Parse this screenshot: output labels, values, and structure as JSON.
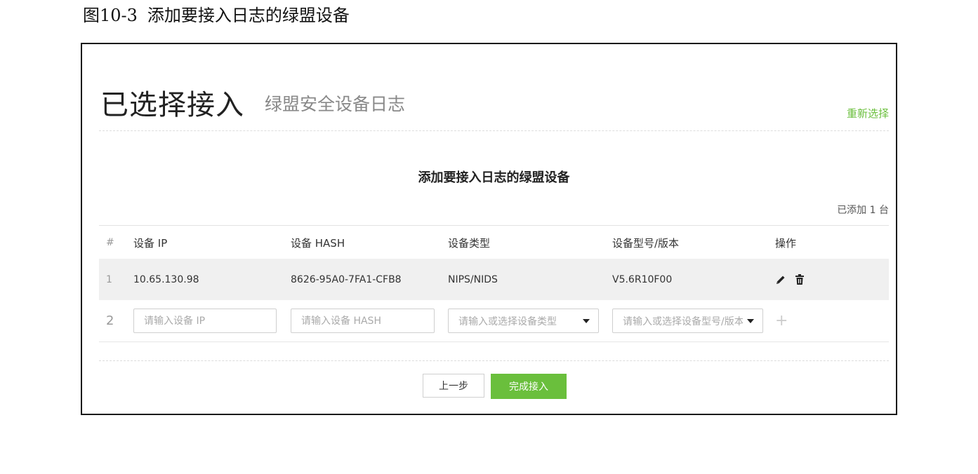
{
  "caption": {
    "number": "图10-3",
    "text": "添加要接入日志的绿盟设备"
  },
  "header": {
    "title": "已选择接入",
    "subtitle": "绿盟安全设备日志",
    "reselect_link": "重新选择"
  },
  "section_title": "添加要接入日志的绿盟设备",
  "added_count": "已添加 1 台",
  "table": {
    "columns": [
      "#",
      "设备 IP",
      "设备 HASH",
      "设备类型",
      "设备型号/版本",
      "操作"
    ],
    "rows": [
      {
        "index": "1",
        "ip": "10.65.130.98",
        "hash": "8626-95A0-7FA1-CFB8",
        "type": "NIPS/NIDS",
        "model": "V5.6R10F00"
      }
    ],
    "new_row": {
      "index": "2",
      "ip_placeholder": "请输入设备 IP",
      "hash_placeholder": "请输入设备 HASH",
      "type_placeholder": "请输入或选择设备类型",
      "model_placeholder": "请输入或选择设备型号/版本"
    }
  },
  "buttons": {
    "back": "上一步",
    "finish": "完成接入"
  },
  "colors": {
    "accent": "#6abf3c",
    "row_highlight": "#f0f0f0"
  },
  "icons": {
    "edit": "pencil-icon",
    "delete": "trash-icon",
    "add": "plus-icon",
    "dropdown": "caret-down-icon"
  }
}
